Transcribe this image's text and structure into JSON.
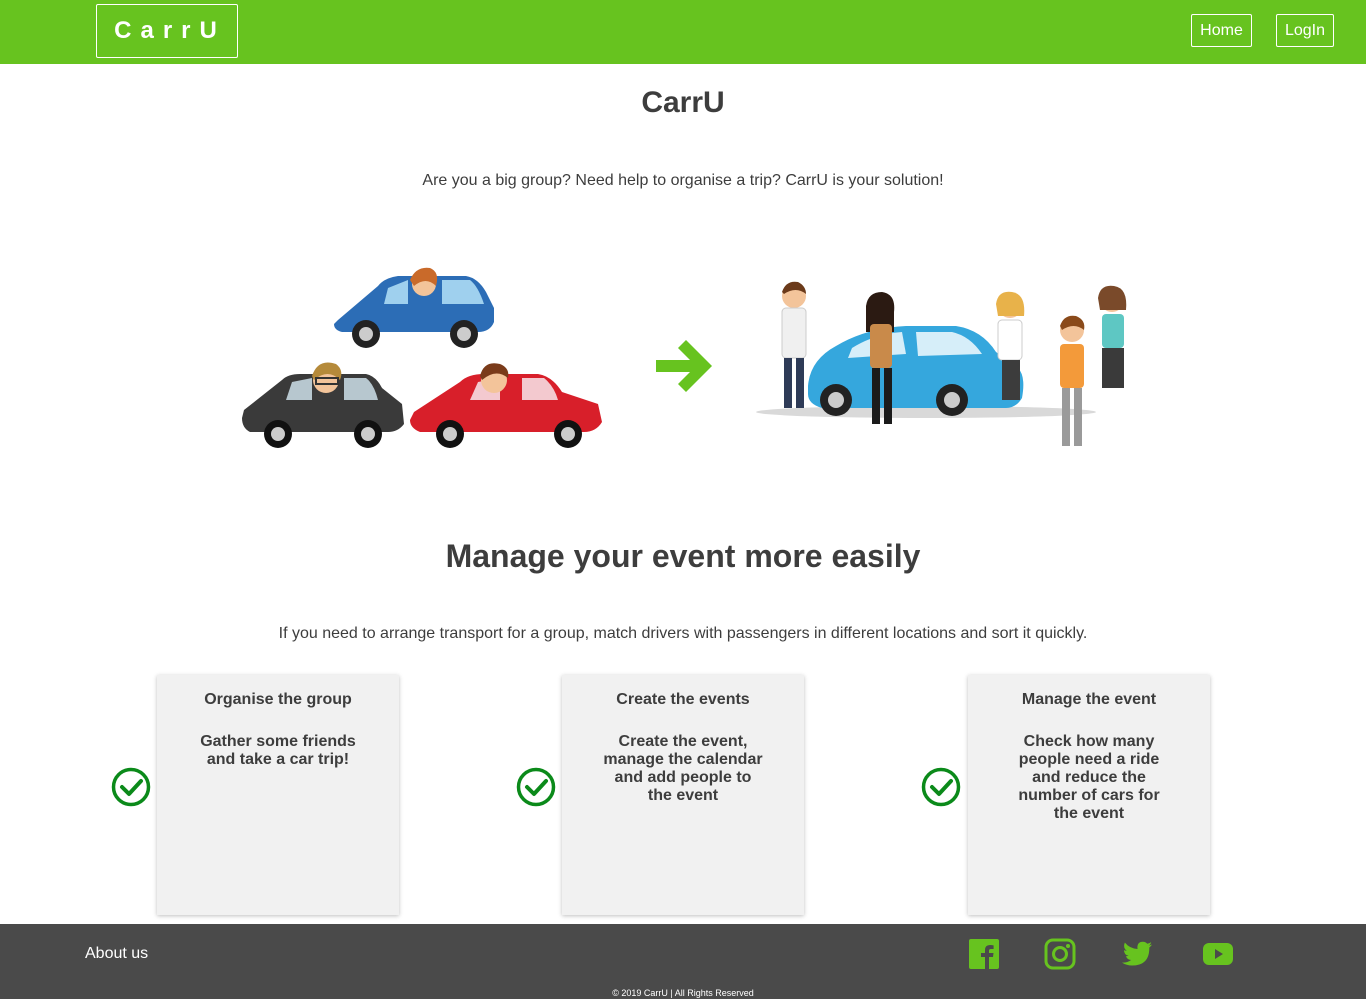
{
  "header": {
    "logo": "CarrU",
    "nav": {
      "home": "Home",
      "login": "LogIn"
    }
  },
  "hero": {
    "title": "CarrU",
    "tagline": "Are you a big group? Need help to organise a trip? CarrU is your solution!"
  },
  "features": {
    "title": "Manage your event more easily",
    "subtitle": "If you need to arrange transport for a group, match drivers with passengers in different locations and sort it quickly.",
    "cards": [
      {
        "title": "Organise the group",
        "text": "Gather some friends and take a car trip!"
      },
      {
        "title": "Create the events",
        "text": "Create the event, manage the calendar and add people to the event"
      },
      {
        "title": "Manage the event",
        "text": "Check how many people need a ride and reduce the number of cars for the event"
      }
    ]
  },
  "footer": {
    "about": "About us",
    "social": [
      "facebook-icon",
      "instagram-icon",
      "twitter-icon",
      "youtube-icon"
    ],
    "copyright": "© 2019 CarrU | All Rights Reserved"
  },
  "colors": {
    "brand_green": "#67c31f",
    "check_green": "#0b8a1a",
    "footer_bg": "#4a4a4a",
    "card_bg": "#f1f1f1"
  }
}
